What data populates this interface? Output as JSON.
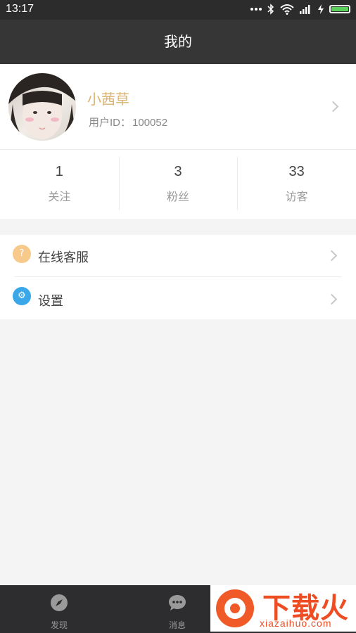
{
  "status_bar": {
    "time": "13:17",
    "battery_color": "#5bd15b"
  },
  "header": {
    "title": "我的"
  },
  "profile": {
    "name": "小茜草",
    "user_id_label": "用户ID：",
    "user_id": "100052",
    "name_color": "#d9b26f"
  },
  "stats": [
    {
      "value": "1",
      "label": "关注"
    },
    {
      "value": "3",
      "label": "粉丝"
    },
    {
      "value": "33",
      "label": "访客"
    }
  ],
  "menu": [
    {
      "label": "在线客服",
      "icon": "question-icon",
      "icon_glyph": "?",
      "icon_color": "#f7c98a"
    },
    {
      "label": "设置",
      "icon": "gear-icon",
      "icon_glyph": "⚙",
      "icon_color": "#3aa8e8"
    }
  ],
  "tabs": [
    {
      "label": "发现",
      "icon": "compass-icon"
    },
    {
      "label": "消息",
      "icon": "chat-bubble-icon"
    }
  ],
  "banner": {
    "text": "下载火",
    "subtext": "xiazaihuo.com"
  }
}
